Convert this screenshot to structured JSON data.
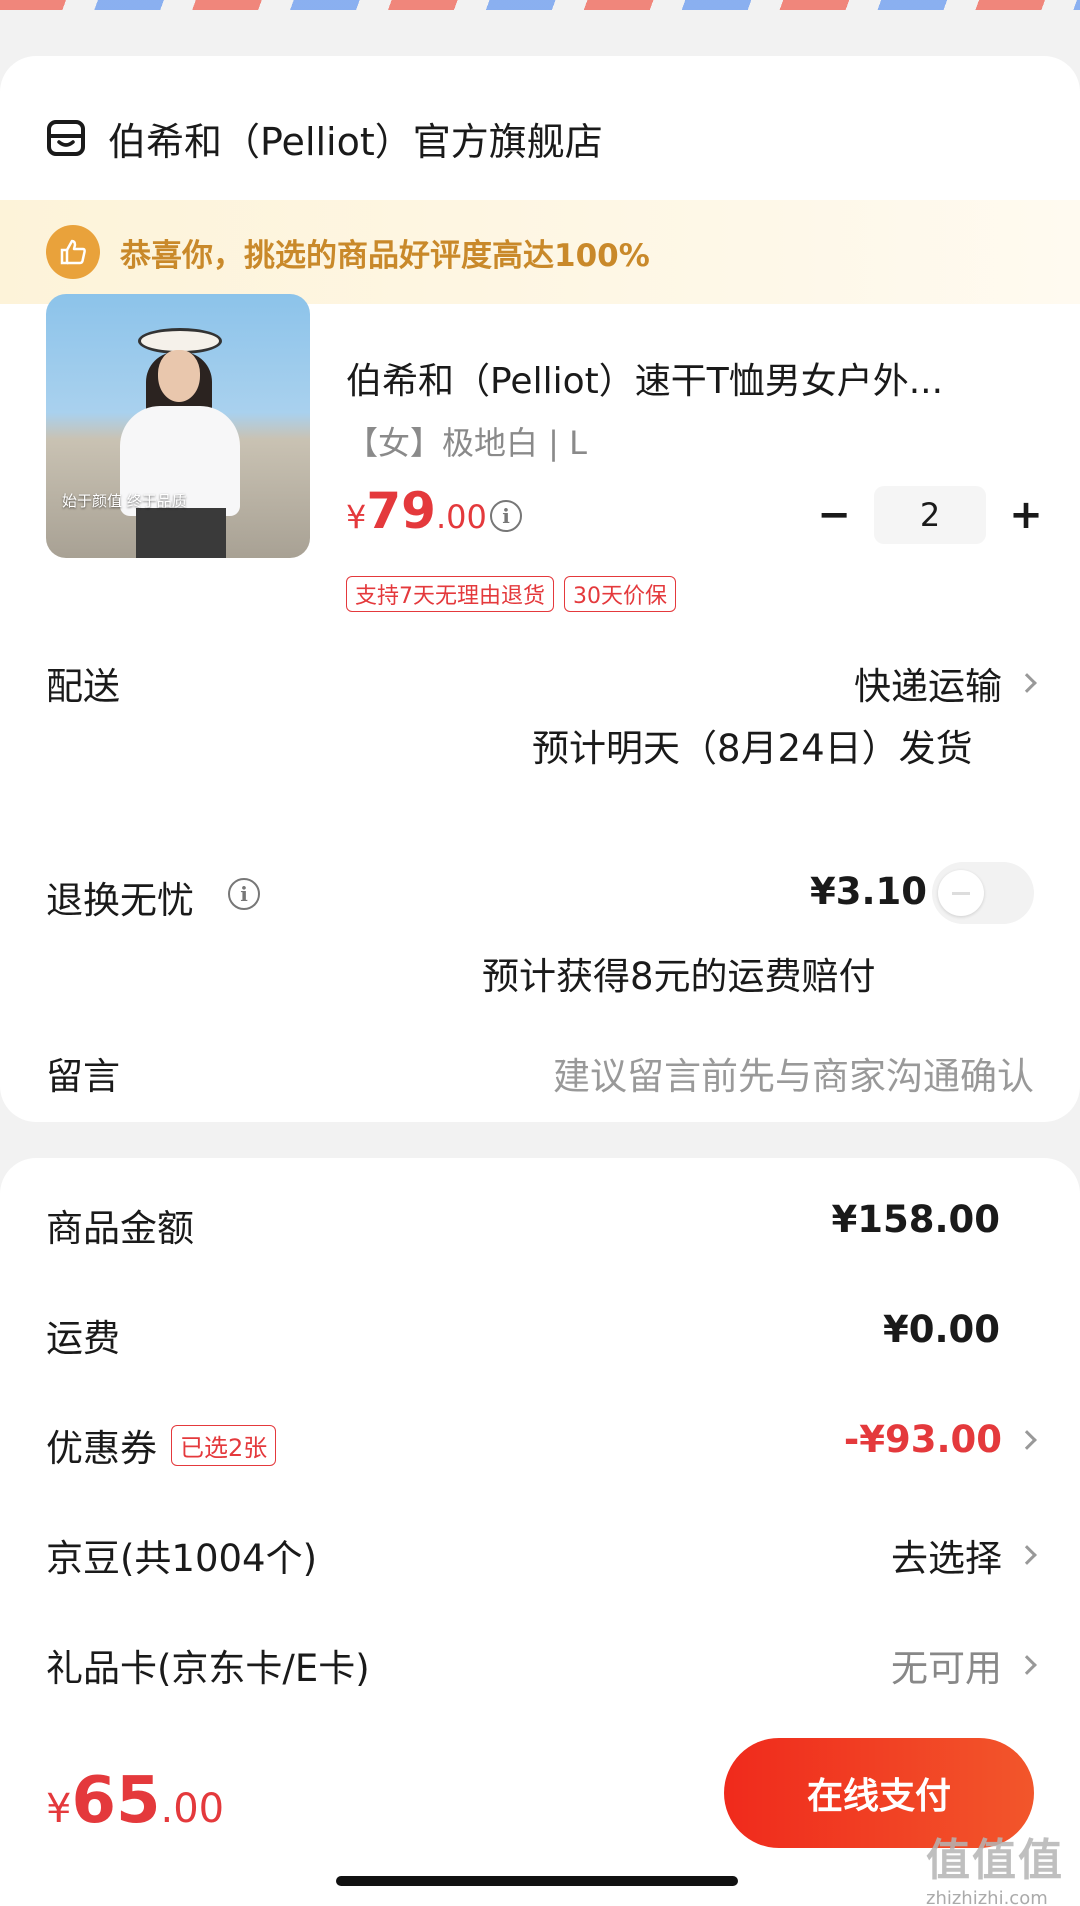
{
  "store": {
    "name": "伯希和（Pelliot）官方旗舰店",
    "icon": "store-icon"
  },
  "banner": {
    "text": "恭喜你，挑选的商品好评度高达100%",
    "icon": "thumbs-up-icon",
    "color": "#c9892a"
  },
  "product": {
    "image_caption": "始于颜值 终于品质",
    "title": "伯希和（Pelliot）速干T恤男女户外...",
    "spec": "【女】极地白 | L",
    "price_currency": "¥",
    "price_int": "79",
    "price_dec": ".00",
    "quantity": "2",
    "minus": "−",
    "plus": "+",
    "tags": [
      "支持7天无理由退货",
      "30天价保"
    ]
  },
  "delivery": {
    "label": "配送",
    "method": "快递运输",
    "estimate": "预计明天（8月24日）发货"
  },
  "return": {
    "label": "退换无忧",
    "price": "¥3.10",
    "note": "预计获得8元的运费赔付",
    "enabled": false
  },
  "message": {
    "label": "留言",
    "placeholder": "建议留言前先与商家沟通确认"
  },
  "summary": {
    "goods_label": "商品金额",
    "goods_value": "¥158.00",
    "shipping_label": "运费",
    "shipping_value": "¥0.00",
    "coupon_label": "优惠券",
    "coupon_badge": "已选2张",
    "coupon_value": "-¥93.00",
    "beans_label": "京豆(共1004个)",
    "beans_value": "去选择",
    "giftcard_label": "礼品卡(京东卡/E卡)",
    "giftcard_value": "无可用"
  },
  "footer": {
    "total_currency": "¥",
    "total_int": "65",
    "total_dec": ".00",
    "pay_label": "在线支付"
  },
  "watermark": {
    "big": "值值值",
    "small": "zhizhizhi.com"
  },
  "colors": {
    "accent_red": "#e4393c",
    "pay_gradient_start": "#f02a1c",
    "pay_gradient_end": "#f2562b"
  }
}
